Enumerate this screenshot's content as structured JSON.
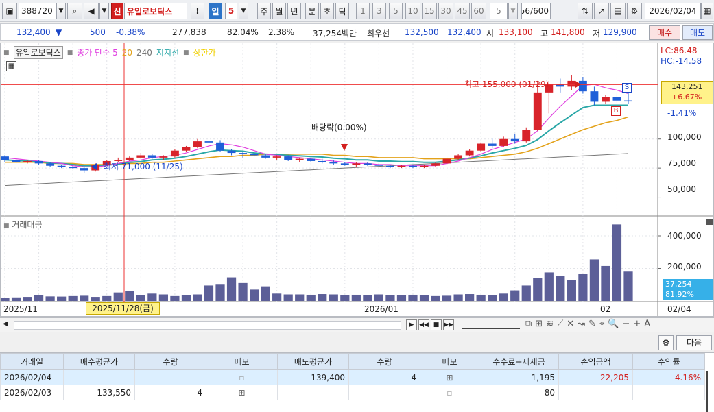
{
  "toolbar": {
    "code": "388720",
    "credit_badge": "신",
    "stock_name": "유일로보틱스",
    "warn_icon": "!",
    "periods": [
      "일",
      "5",
      "주",
      "월",
      "년",
      "분",
      "초",
      "틱"
    ],
    "intervals": [
      "1",
      "3",
      "5",
      "10",
      "15",
      "30",
      "45",
      "60"
    ],
    "interval_input": "5",
    "count": "56",
    "count_total": "/600",
    "date": "2026/02/04"
  },
  "quote": {
    "price": "132,400",
    "change": "500",
    "change_pct": "-0.38%",
    "volume": "277,838",
    "vol_ratio": "82.04%",
    "turnover": "2.38%",
    "amount": "37,254백만",
    "best_label": "최우선",
    "best_ask": "132,500",
    "best_bid": "132,400",
    "open_label": "시",
    "open": "133,100",
    "high_label": "고",
    "high": "141,800",
    "low_label": "저",
    "low": "129,900",
    "buy_btn": "매수",
    "sell_btn": "매도"
  },
  "chart_legend": {
    "name": "유일로보틱스",
    "ma_label": "종가 단순 5",
    "ma20": "20",
    "ma240": "240",
    "support": "지지선",
    "limit": "상한가"
  },
  "chart_labels": {
    "lc": "LC:86.48",
    "hc": "HC:-14.58",
    "price_box_1": "143,251",
    "price_box_2": "+6.67%",
    "price_box_3": "-1.41%",
    "high_note": "최고 155,000 (01/29)",
    "low_note": "최저 71,000 (11/25)",
    "dividend_note": "배당락(0.00%)",
    "sell_marker": "S",
    "buy_marker": "B",
    "volume_title": "거래대금",
    "vol_box_1": "37,254",
    "vol_box_2": "81.92%",
    "cursor_date": "2025/11/28(금)"
  },
  "chart_data": [
    {
      "type": "candlestick",
      "title": "",
      "y_ticks": [
        "100,000",
        "75,000",
        "50,000"
      ],
      "x_ticks": [
        "2025/11",
        "2026/01",
        "02",
        "02/04"
      ],
      "ohlc": [
        [
          85000,
          86000,
          80000,
          82000
        ],
        [
          82000,
          83000,
          79000,
          80000
        ],
        [
          80000,
          82000,
          79000,
          81000
        ],
        [
          81000,
          82000,
          78000,
          79000
        ],
        [
          79000,
          80000,
          76000,
          77000
        ],
        [
          77000,
          78000,
          75000,
          76000
        ],
        [
          76000,
          77000,
          74000,
          75000
        ],
        [
          75000,
          76000,
          71000,
          73000
        ],
        [
          73000,
          79000,
          72000,
          78000
        ],
        [
          78000,
          82000,
          77000,
          81000
        ],
        [
          81000,
          84000,
          80000,
          82000
        ],
        [
          82000,
          85000,
          81000,
          84000
        ],
        [
          84000,
          88000,
          83000,
          86000
        ],
        [
          86000,
          87000,
          83000,
          84000
        ],
        [
          84000,
          86000,
          82000,
          85000
        ],
        [
          85000,
          91000,
          84000,
          90000
        ],
        [
          90000,
          94000,
          89000,
          93000
        ],
        [
          93000,
          100000,
          92000,
          98000
        ],
        [
          98000,
          101000,
          95000,
          97000
        ],
        [
          97000,
          99000,
          89000,
          90000
        ],
        [
          90000,
          91000,
          86000,
          88000
        ],
        [
          88000,
          89000,
          84000,
          87000
        ],
        [
          87000,
          89000,
          85000,
          86000
        ],
        [
          86000,
          87000,
          83000,
          84000
        ],
        [
          84000,
          86000,
          82000,
          85000
        ],
        [
          85000,
          86000,
          81000,
          82000
        ],
        [
          82000,
          84000,
          80000,
          83000
        ],
        [
          83000,
          84000,
          80000,
          81000
        ],
        [
          81000,
          83000,
          79000,
          80000
        ],
        [
          80000,
          82000,
          78000,
          79000
        ],
        [
          79000,
          80000,
          77000,
          78000
        ],
        [
          78000,
          80000,
          76000,
          79000
        ],
        [
          79000,
          80000,
          77000,
          78000
        ],
        [
          78000,
          79000,
          76000,
          77000
        ],
        [
          77000,
          78000,
          75000,
          76000
        ],
        [
          76000,
          78000,
          75000,
          77000
        ],
        [
          77000,
          78000,
          75000,
          76000
        ],
        [
          76000,
          78000,
          75000,
          77000
        ],
        [
          77000,
          80000,
          76000,
          79000
        ],
        [
          79000,
          84000,
          78000,
          83000
        ],
        [
          83000,
          87000,
          82000,
          86000
        ],
        [
          86000,
          91000,
          85000,
          90000
        ],
        [
          90000,
          97000,
          89000,
          96000
        ],
        [
          96000,
          101000,
          92000,
          94000
        ],
        [
          94000,
          102000,
          93000,
          100000
        ],
        [
          100000,
          104000,
          96000,
          98000
        ],
        [
          98000,
          110000,
          97000,
          108000
        ],
        [
          108000,
          150000,
          107000,
          140000
        ],
        [
          140000,
          150000,
          122000,
          147000
        ],
        [
          147000,
          152000,
          140000,
          145000
        ],
        [
          145000,
          155000,
          142000,
          150000
        ],
        [
          150000,
          153000,
          139000,
          141000
        ],
        [
          141000,
          145000,
          129000,
          132000
        ],
        [
          132000,
          138000,
          130000,
          136000
        ],
        [
          136000,
          140000,
          131000,
          133000
        ],
        [
          133100,
          141800,
          129900,
          132400
        ]
      ],
      "ma5": [
        84000,
        83000,
        82000,
        81000,
        80000,
        79000,
        77000,
        76000,
        76000,
        77000,
        79000,
        81000,
        82000,
        84000,
        85000,
        86000,
        88000,
        91000,
        94000,
        96000,
        95000,
        93000,
        90000,
        87000,
        86000,
        85000,
        84000,
        83000,
        82000,
        81000,
        80000,
        79000,
        79000,
        78000,
        78000,
        77000,
        77000,
        77000,
        77000,
        79000,
        81000,
        84000,
        87000,
        91000,
        94000,
        97000,
        100000,
        107000,
        118000,
        128000,
        137000,
        146000,
        147000,
        144000,
        142000,
        139000
      ],
      "ma20": [
        80000,
        80000,
        80000,
        80000,
        79000,
        79000,
        79000,
        78000,
        78000,
        78000,
        78000,
        79000,
        79000,
        80000,
        80000,
        81000,
        82000,
        83000,
        84000,
        85000,
        85000,
        86000,
        86000,
        87000,
        87000,
        87000,
        87000,
        87000,
        87000,
        86000,
        86000,
        85000,
        85000,
        84000,
        84000,
        84000,
        84000,
        83000,
        83000,
        83000,
        83000,
        83000,
        84000,
        85000,
        86000,
        87000,
        89000,
        92000,
        96000,
        100000,
        104000,
        108000,
        111000,
        114000,
        116000,
        119000
      ],
      "ma240": [
        60000,
        60500,
        61000,
        61500,
        62000,
        62500,
        63000,
        63500,
        64000,
        64500,
        65000,
        65500,
        66000,
        66500,
        67000,
        67500,
        68000,
        68500,
        69000,
        69500,
        70000,
        70500,
        71000,
        71500,
        72000,
        72500,
        73000,
        73500,
        74000,
        74500,
        75000,
        75500,
        76000,
        76500,
        77000,
        77500,
        78000,
        78500,
        79000,
        79500,
        80000,
        80500,
        81000,
        81500,
        82000,
        82500,
        83000,
        83500,
        84000,
        84500,
        85000,
        85500,
        86000,
        86500,
        87000,
        87500
      ],
      "ylim": [
        35000,
        180000
      ]
    },
    {
      "type": "bar",
      "title": "거래대금",
      "y_ticks": [
        "400,000",
        "200,000"
      ],
      "values": [
        20000,
        22000,
        25000,
        35000,
        28000,
        27000,
        30000,
        32000,
        25000,
        30000,
        52000,
        60000,
        35000,
        45000,
        40000,
        30000,
        35000,
        40000,
        95000,
        100000,
        145000,
        110000,
        70000,
        90000,
        45000,
        40000,
        40000,
        38000,
        42000,
        40000,
        35000,
        38000,
        36000,
        40000,
        34000,
        35000,
        38000,
        35000,
        30000,
        32000,
        40000,
        42000,
        38000,
        35000,
        45000,
        65000,
        95000,
        140000,
        175000,
        155000,
        130000,
        165000,
        255000,
        215000,
        470000,
        180000
      ],
      "ylim": [
        0,
        480000
      ]
    }
  ],
  "ops": {
    "next_button": "다음"
  },
  "table": {
    "headers": [
      "거래일",
      "매수평균가",
      "수량",
      "메모",
      "매도평균가",
      "수량",
      "메모",
      "수수료+제세금",
      "손익금액",
      "수익률"
    ],
    "rows": [
      [
        "2026/02/04",
        "",
        "",
        "",
        "139,400",
        "4",
        "",
        "1,195",
        "22,205",
        "4.16%"
      ],
      [
        "2026/02/03",
        "133,550",
        "4",
        "",
        "",
        "",
        "",
        "80",
        "",
        ""
      ]
    ]
  },
  "colors": {
    "up": "#d8232a",
    "down": "#1f5fd8",
    "ma5": "#e040e0",
    "ma20": "#2aa7a7",
    "ma60": "#e3a21a",
    "ma240": "#777777"
  }
}
